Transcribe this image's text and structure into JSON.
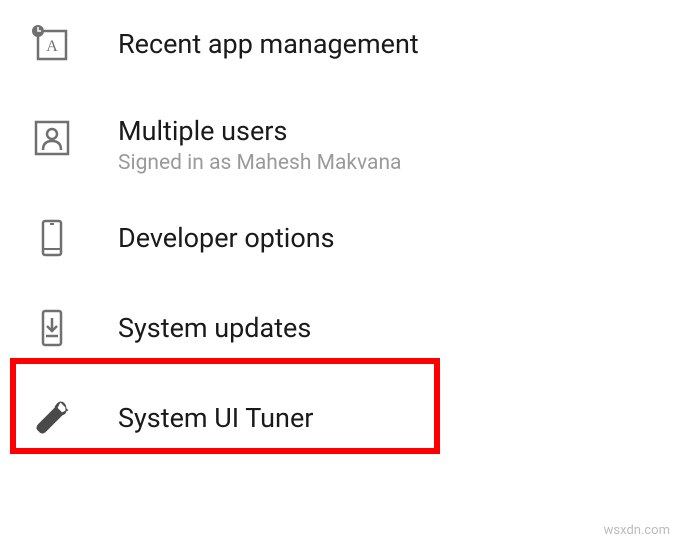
{
  "settings": {
    "items": [
      {
        "id": "recent-app-management",
        "title": "Recent app management",
        "subtitle": null,
        "icon": "recent-app-icon"
      },
      {
        "id": "multiple-users",
        "title": "Multiple users",
        "subtitle": "Signed in as Mahesh Makvana",
        "icon": "user-icon"
      },
      {
        "id": "developer-options",
        "title": "Developer options",
        "subtitle": null,
        "icon": "phone-icon"
      },
      {
        "id": "system-updates",
        "title": "System updates",
        "subtitle": null,
        "icon": "update-icon",
        "highlighted": true
      },
      {
        "id": "system-ui-tuner",
        "title": "System UI Tuner",
        "subtitle": null,
        "icon": "wrench-icon"
      }
    ]
  },
  "watermark": "wsxdn.com"
}
